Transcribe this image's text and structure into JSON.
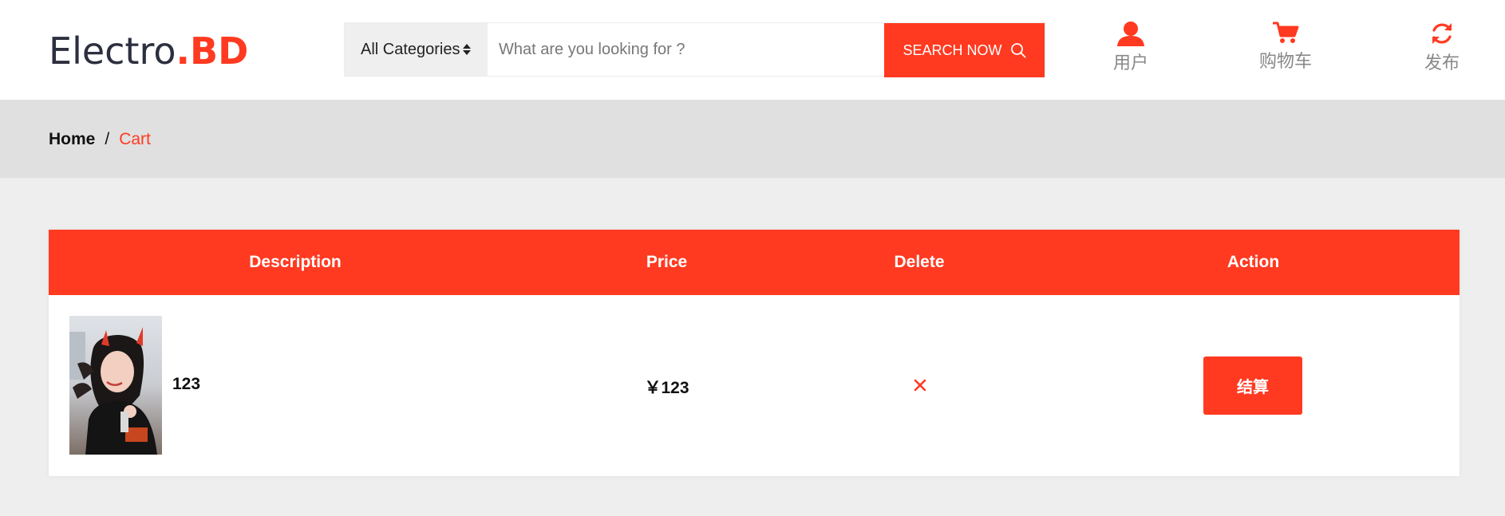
{
  "brand": {
    "name": "Electro",
    "accent": ".BD",
    "accent_color": "#ff3a21"
  },
  "search": {
    "category": "All Categories",
    "placeholder": "What are you looking for ?",
    "button_label": "SEARCH NOW"
  },
  "nav": [
    {
      "label": "用户",
      "icon": "user-icon"
    },
    {
      "label": "购物车",
      "icon": "cart-icon"
    },
    {
      "label": "发布",
      "icon": "refresh-icon"
    }
  ],
  "breadcrumb": {
    "home": "Home",
    "separator": "/",
    "current": "Cart"
  },
  "table": {
    "headers": {
      "description": "Description",
      "price": "Price",
      "delete": "Delete",
      "action": "Action"
    },
    "rows": [
      {
        "name": "123",
        "price": "￥123",
        "image": "product-photo",
        "delete_icon": "close-icon",
        "action_label": "结算"
      }
    ]
  },
  "colors": {
    "primary": "#ff3a21",
    "breadcrumb_bg": "#e0e0e0",
    "page_bg": "#eeeeee"
  }
}
